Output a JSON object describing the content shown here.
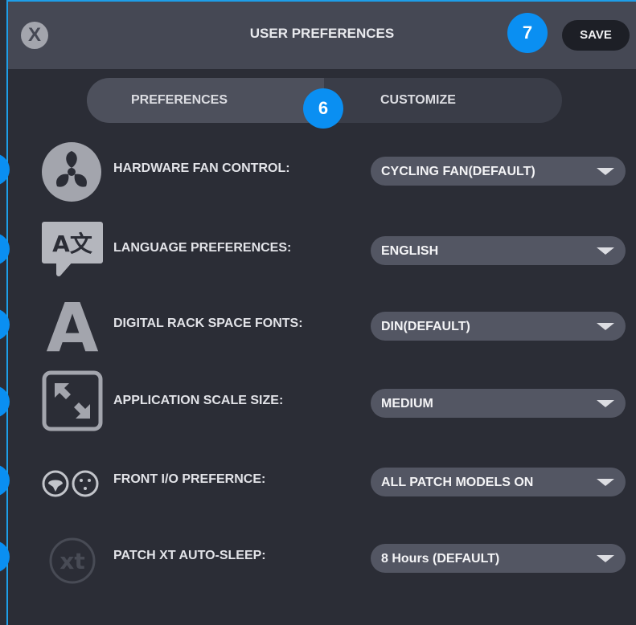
{
  "header": {
    "close_label": "X",
    "title": "USER PREFERENCES",
    "save_label": "SAVE",
    "badge_save": "7"
  },
  "tabs": {
    "preferences": "PREFERENCES",
    "customize": "CUSTOMIZE",
    "badge_tabs": "6"
  },
  "settings": [
    {
      "label": "HARDWARE FAN CONTROL:",
      "value": "CYCLING FAN(DEFAULT)",
      "icon": "fan-icon"
    },
    {
      "label": "LANGUAGE PREFERENCES:",
      "value": "ENGLISH",
      "icon": "language-icon",
      "icon_text": "A文"
    },
    {
      "label": "DIGITAL RACK SPACE FONTS:",
      "value": "DIN(DEFAULT)",
      "icon": "font-icon",
      "icon_text": "A"
    },
    {
      "label": "APPLICATION SCALE SIZE:",
      "value": "MEDIUM",
      "icon": "scale-icon"
    },
    {
      "label": "FRONT I/O PREFERNCE:",
      "value": "ALL PATCH MODELS ON",
      "icon": "front-io-icon"
    },
    {
      "label": "PATCH XT AUTO-SLEEP:",
      "value": "8 Hours (DEFAULT)",
      "icon": "xt-icon",
      "icon_text": "xt"
    }
  ],
  "colors": {
    "background": "#2b2d36",
    "titlebar": "#454854",
    "dropdown": "#535663",
    "accent_badge": "#0a8ff2",
    "frame": "#1e9ee8"
  }
}
